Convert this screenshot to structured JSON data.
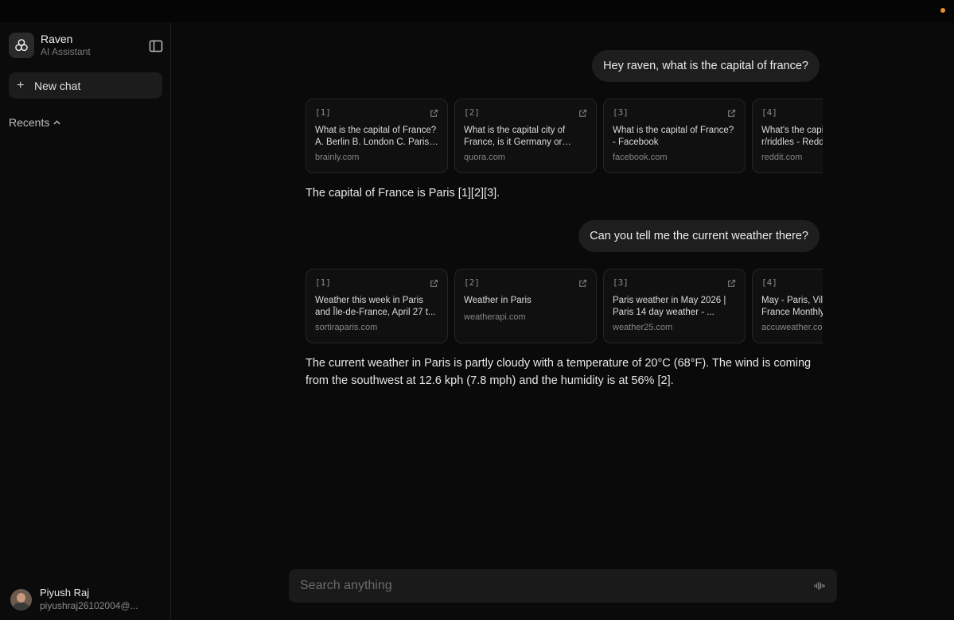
{
  "app": {
    "name": "Raven",
    "subtitle": "AI Assistant"
  },
  "sidebar": {
    "new_chat_label": "New chat",
    "recents_label": "Recents"
  },
  "user": {
    "name": "Piyush Raj",
    "email": "piyushraj26102004@..."
  },
  "conversation": [
    {
      "user_message": "Hey raven, what is the capital of france?",
      "sources": [
        {
          "index": "[1]",
          "title": "What is the capital of France? A. Berlin B. London C. Paris ...",
          "domain": "brainly.com"
        },
        {
          "index": "[2]",
          "title": "What is the capital city of France, is it Germany or Pari...",
          "domain": "quora.com"
        },
        {
          "index": "[3]",
          "title": "What is the capital of France? - Facebook",
          "domain": "facebook.com"
        },
        {
          "index": "[4]",
          "title": "What's the capital of France? : r/riddles - Reddit",
          "domain": "reddit.com"
        }
      ],
      "answer": "The capital of France is Paris [1][2][3]."
    },
    {
      "user_message": "Can you tell me the current weather there?",
      "sources": [
        {
          "index": "[1]",
          "title": "Weather this week in Paris and Île-de-France, April 27 t...",
          "domain": "sortiraparis.com"
        },
        {
          "index": "[2]",
          "title": "Weather in Paris",
          "domain": "weatherapi.com"
        },
        {
          "index": "[3]",
          "title": "Paris weather in May 2026 | Paris 14 day weather - ...",
          "domain": "weather25.com"
        },
        {
          "index": "[4]",
          "title": "May - Paris, Ville de Paris, France Monthly Weather",
          "domain": "accuweather.com"
        }
      ],
      "answer": "The current weather in Paris is partly cloudy with a temperature of 20°C (68°F). The wind is coming from the southwest at 12.6 kph (7.8 mph) and the humidity is at 56% [2]."
    }
  ],
  "composer": {
    "placeholder": "Search anything"
  },
  "colors": {
    "background": "#0a0a0a",
    "bubble": "#1e1e1e",
    "card_border": "#262626",
    "status_dot": "#e8902a"
  },
  "icons": {
    "logo": "raven-logo-icon",
    "sidebar_toggle": "sidebar-toggle-icon",
    "new_chat": "plus-icon",
    "recents": "chevron-up-icon",
    "source_link": "external-link-icon",
    "voice": "waveform-icon"
  }
}
